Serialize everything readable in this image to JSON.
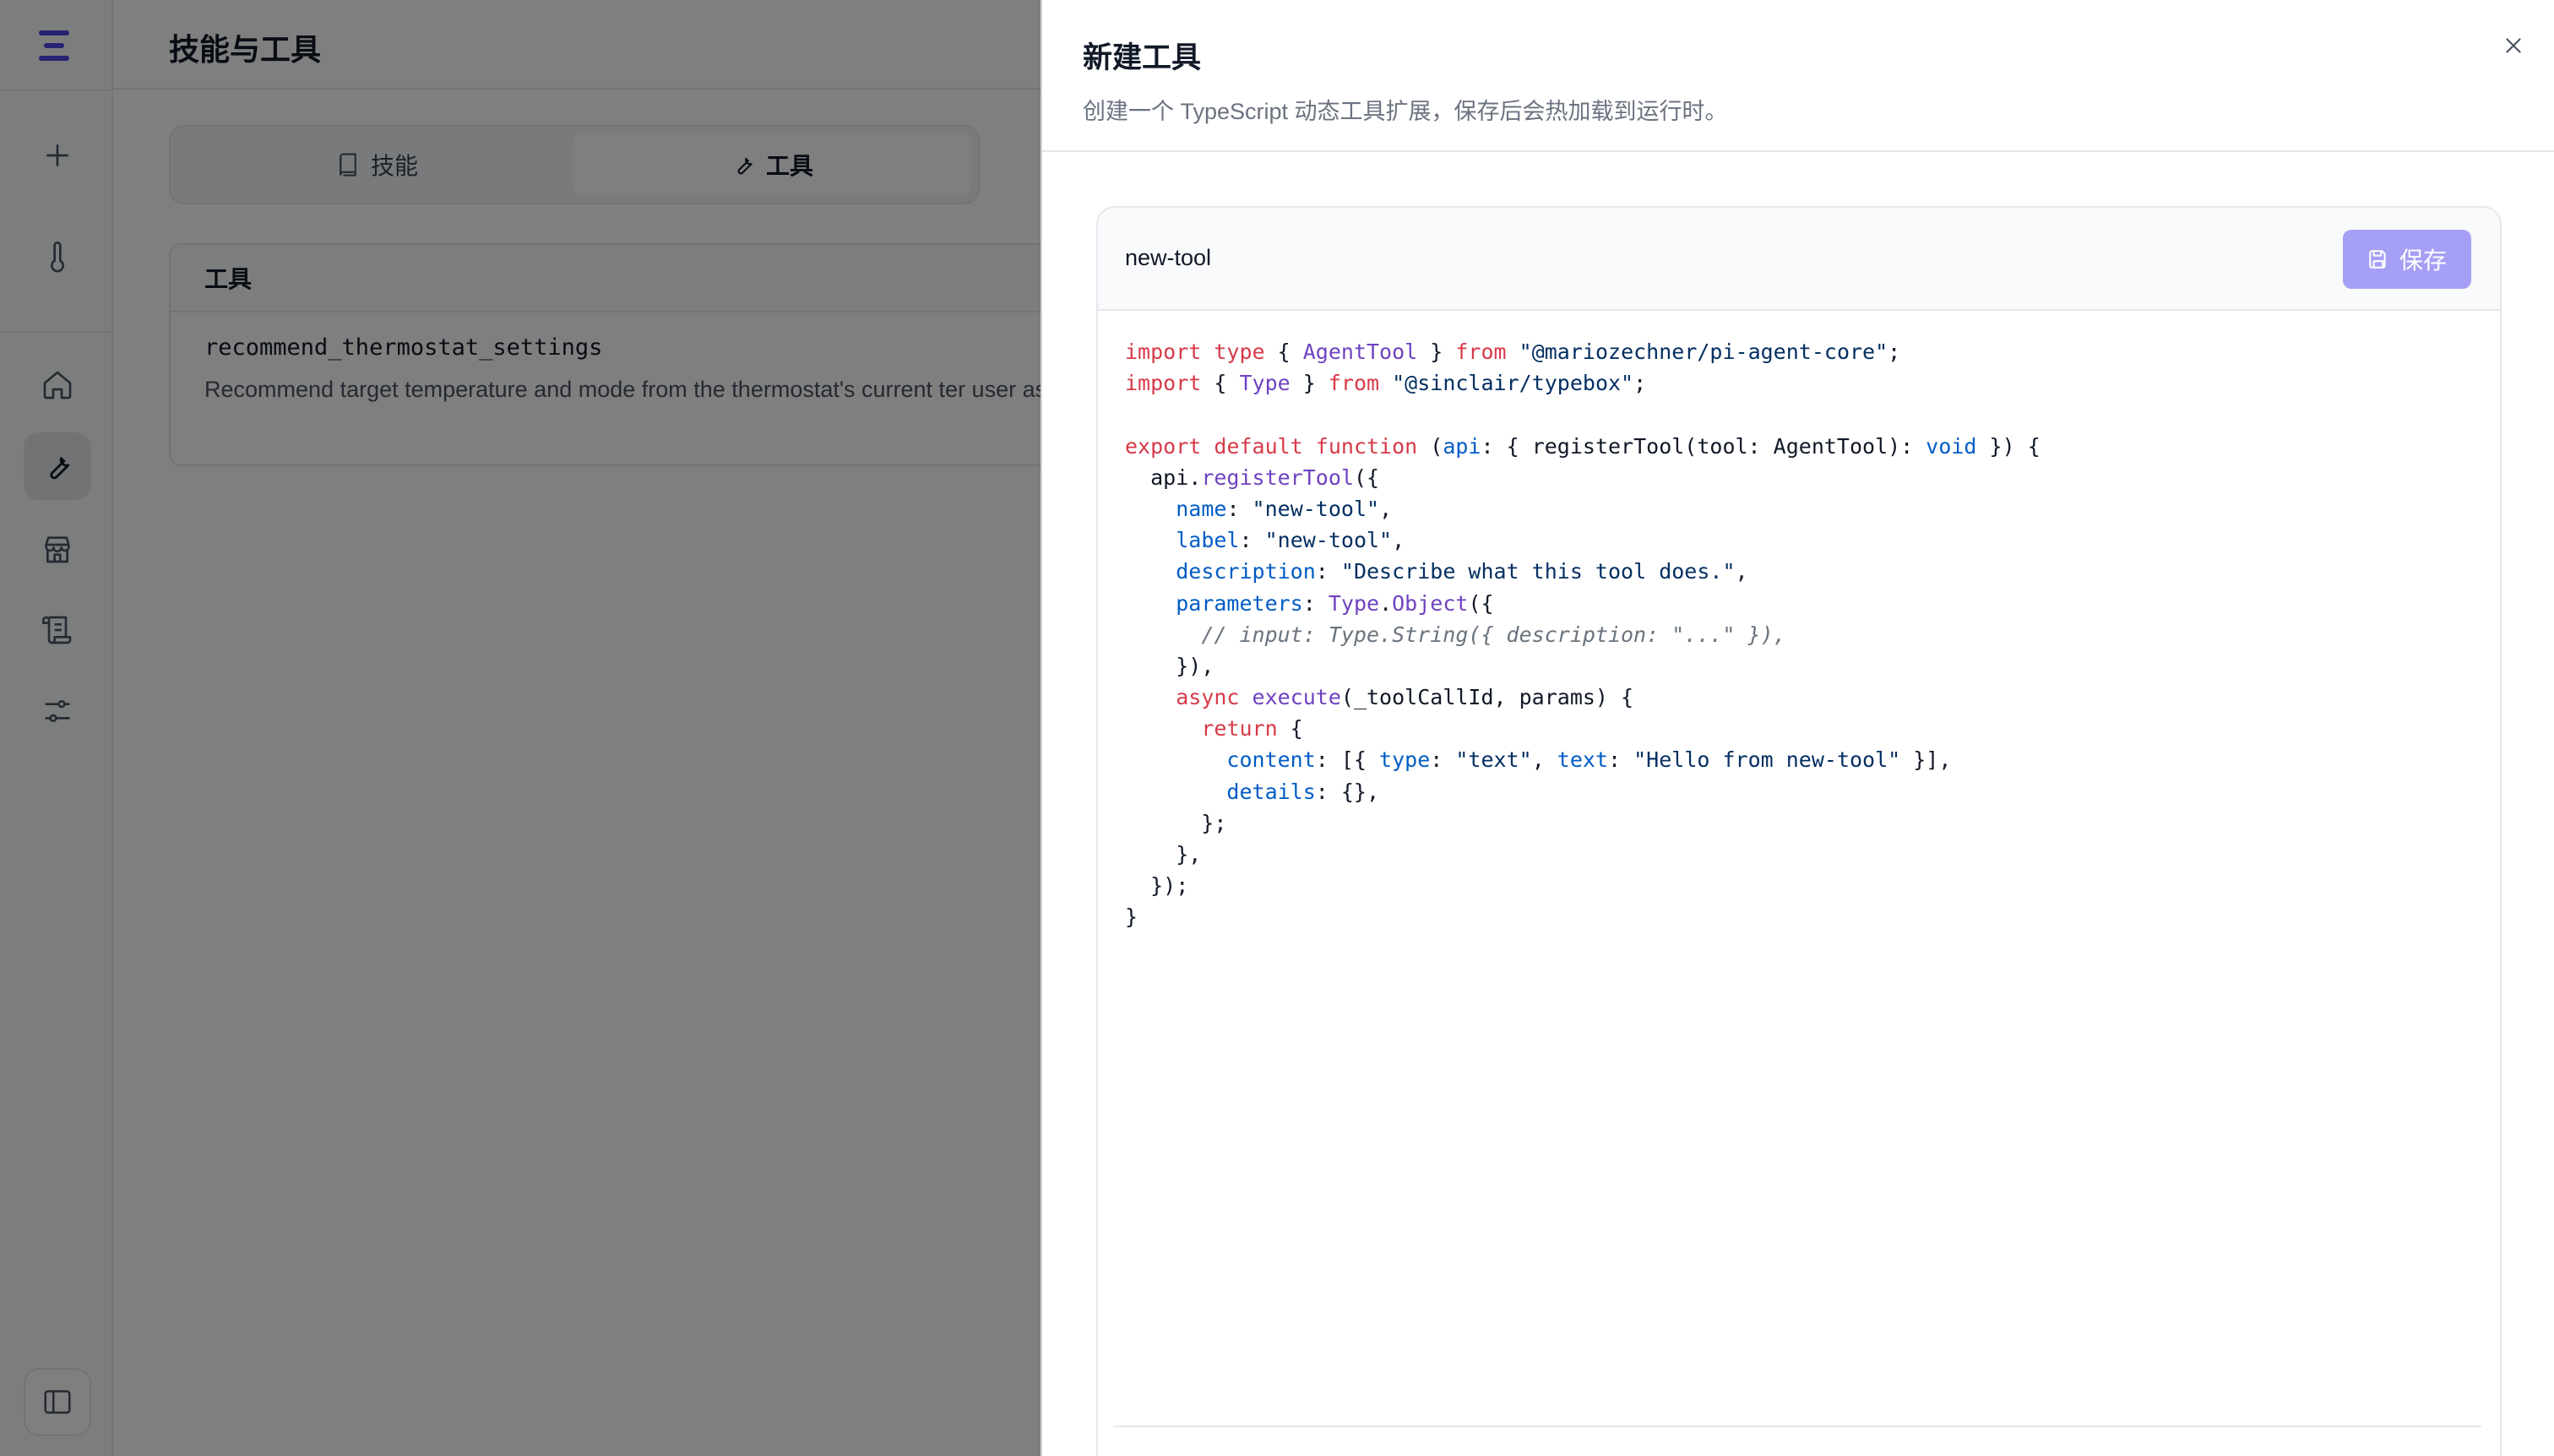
{
  "app": {
    "title": "技能与工具",
    "sidebar": {
      "icons": [
        "menu-logo-icon",
        "plus-icon",
        "thermometer-icon",
        "home-icon",
        "wrench-icon",
        "store-icon",
        "scroll-icon",
        "sliders-icon",
        "sidebar-toggle-icon"
      ]
    },
    "tabs": [
      {
        "label": "技能",
        "icon": "book-icon",
        "active": false
      },
      {
        "label": "工具",
        "icon": "wrench-icon",
        "active": true
      }
    ],
    "table": {
      "header": "工具",
      "rows": [
        {
          "name": "recommend_thermostat_settings",
          "description": "Recommend target temperature and mode from the thermostat's current ter user asks for energy-saving advice, comfort adjustment, or thermostat adju"
        }
      ]
    }
  },
  "drawer": {
    "title": "新建工具",
    "subtitle": "创建一个 TypeScript 动态工具扩展，保存后会热加载到运行时。",
    "close_icon": "close-icon",
    "file_name": "new-tool",
    "save_label": "保存",
    "save_icon": "save-icon",
    "accent": "#a5a0f5",
    "code_lines": [
      [
        [
          "kw",
          "import"
        ],
        [
          "",
          " "
        ],
        [
          "kw",
          "type"
        ],
        [
          "",
          " { "
        ],
        [
          "ty",
          "AgentTool"
        ],
        [
          "",
          " } "
        ],
        [
          "kw",
          "from"
        ],
        [
          "",
          " "
        ],
        [
          "st",
          "\"@mariozechner/pi-agent-core\""
        ],
        [
          "",
          ";"
        ]
      ],
      [
        [
          "kw",
          "import"
        ],
        [
          "",
          " { "
        ],
        [
          "ty",
          "Type"
        ],
        [
          "",
          " } "
        ],
        [
          "kw",
          "from"
        ],
        [
          "",
          " "
        ],
        [
          "st",
          "\"@sinclair/typebox\""
        ],
        [
          "",
          ";"
        ]
      ],
      [],
      [
        [
          "kw",
          "export"
        ],
        [
          "",
          " "
        ],
        [
          "kw",
          "default"
        ],
        [
          "",
          " "
        ],
        [
          "kw",
          "function"
        ],
        [
          "",
          " ("
        ],
        [
          "pr",
          "api"
        ],
        [
          "",
          ": { registerTool(tool: AgentTool): "
        ],
        [
          "pr",
          "void"
        ],
        [
          "",
          " }) {"
        ]
      ],
      [
        [
          "",
          "  api."
        ],
        [
          "ty",
          "registerTool"
        ],
        [
          "",
          "({"
        ]
      ],
      [
        [
          "",
          "    "
        ],
        [
          "pr",
          "name"
        ],
        [
          "",
          ": "
        ],
        [
          "st",
          "\"new-tool\""
        ],
        [
          "",
          ","
        ]
      ],
      [
        [
          "",
          "    "
        ],
        [
          "pr",
          "label"
        ],
        [
          "",
          ": "
        ],
        [
          "st",
          "\"new-tool\""
        ],
        [
          "",
          ","
        ]
      ],
      [
        [
          "",
          "    "
        ],
        [
          "pr",
          "description"
        ],
        [
          "",
          ": "
        ],
        [
          "st",
          "\"Describe what this tool does.\""
        ],
        [
          "",
          ","
        ]
      ],
      [
        [
          "",
          "    "
        ],
        [
          "pr",
          "parameters"
        ],
        [
          "",
          ": "
        ],
        [
          "ty",
          "Type"
        ],
        [
          "",
          "."
        ],
        [
          "ty",
          "Object"
        ],
        [
          "",
          "({"
        ]
      ],
      [
        [
          "",
          "      "
        ],
        [
          "cm",
          "// input: Type.String({ description: \"...\" }),"
        ]
      ],
      [
        [
          "",
          "    }),"
        ]
      ],
      [
        [
          "",
          "    "
        ],
        [
          "kw",
          "async"
        ],
        [
          "",
          " "
        ],
        [
          "ty",
          "execute"
        ],
        [
          "",
          "(_toolCallId, params) {"
        ]
      ],
      [
        [
          "",
          "      "
        ],
        [
          "kw",
          "return"
        ],
        [
          "",
          " {"
        ]
      ],
      [
        [
          "",
          "        "
        ],
        [
          "pr",
          "content"
        ],
        [
          "",
          ": [{ "
        ],
        [
          "pr",
          "type"
        ],
        [
          "",
          ": "
        ],
        [
          "st",
          "\"text\""
        ],
        [
          "",
          ", "
        ],
        [
          "pr",
          "text"
        ],
        [
          "",
          ": "
        ],
        [
          "st",
          "\"Hello from new-tool\""
        ],
        [
          "",
          " }],"
        ]
      ],
      [
        [
          "",
          "        "
        ],
        [
          "pr",
          "details"
        ],
        [
          "",
          ": {},"
        ]
      ],
      [
        [
          "",
          "      };"
        ]
      ],
      [
        [
          "",
          "    },"
        ]
      ],
      [
        [
          "",
          "  });"
        ]
      ],
      [
        [
          "",
          "}"
        ]
      ]
    ]
  }
}
